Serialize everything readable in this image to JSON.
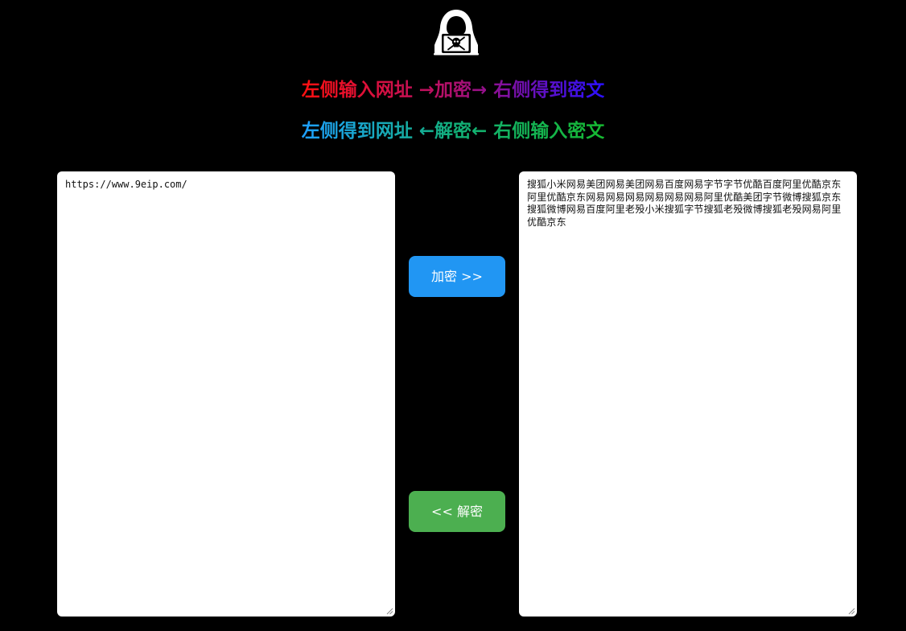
{
  "logo": {
    "icon": "hacker-skull-laptop-icon"
  },
  "headline": {
    "line1": "左侧输入网址 →加密→ 右侧得到密文",
    "line2": "左侧得到网址 ←解密← 右侧输入密文",
    "line1_colors": [
      "#ff1010",
      "#b0106e",
      "#2a10ff"
    ],
    "line2_colors": [
      "#1ea0ff",
      "#12b07a",
      "#16b830"
    ]
  },
  "left_input": {
    "value": "https://www.9eip.com/"
  },
  "right_input": {
    "value": "搜狐小米网易美团网易美团网易百度网易字节字节优酷百度阿里优酷京东阿里优酷京东网易网易网易网易网易网易阿里优酷美团字节微博搜狐京东搜狐微博网易百度阿里老殁小米搜狐字节搜狐老殁微博搜狐老殁网易阿里优酷京东"
  },
  "buttons": {
    "encrypt_label": "加密 >>",
    "decrypt_label": "<< 解密",
    "encrypt_color": "#2196f3",
    "decrypt_color": "#4caf50"
  }
}
